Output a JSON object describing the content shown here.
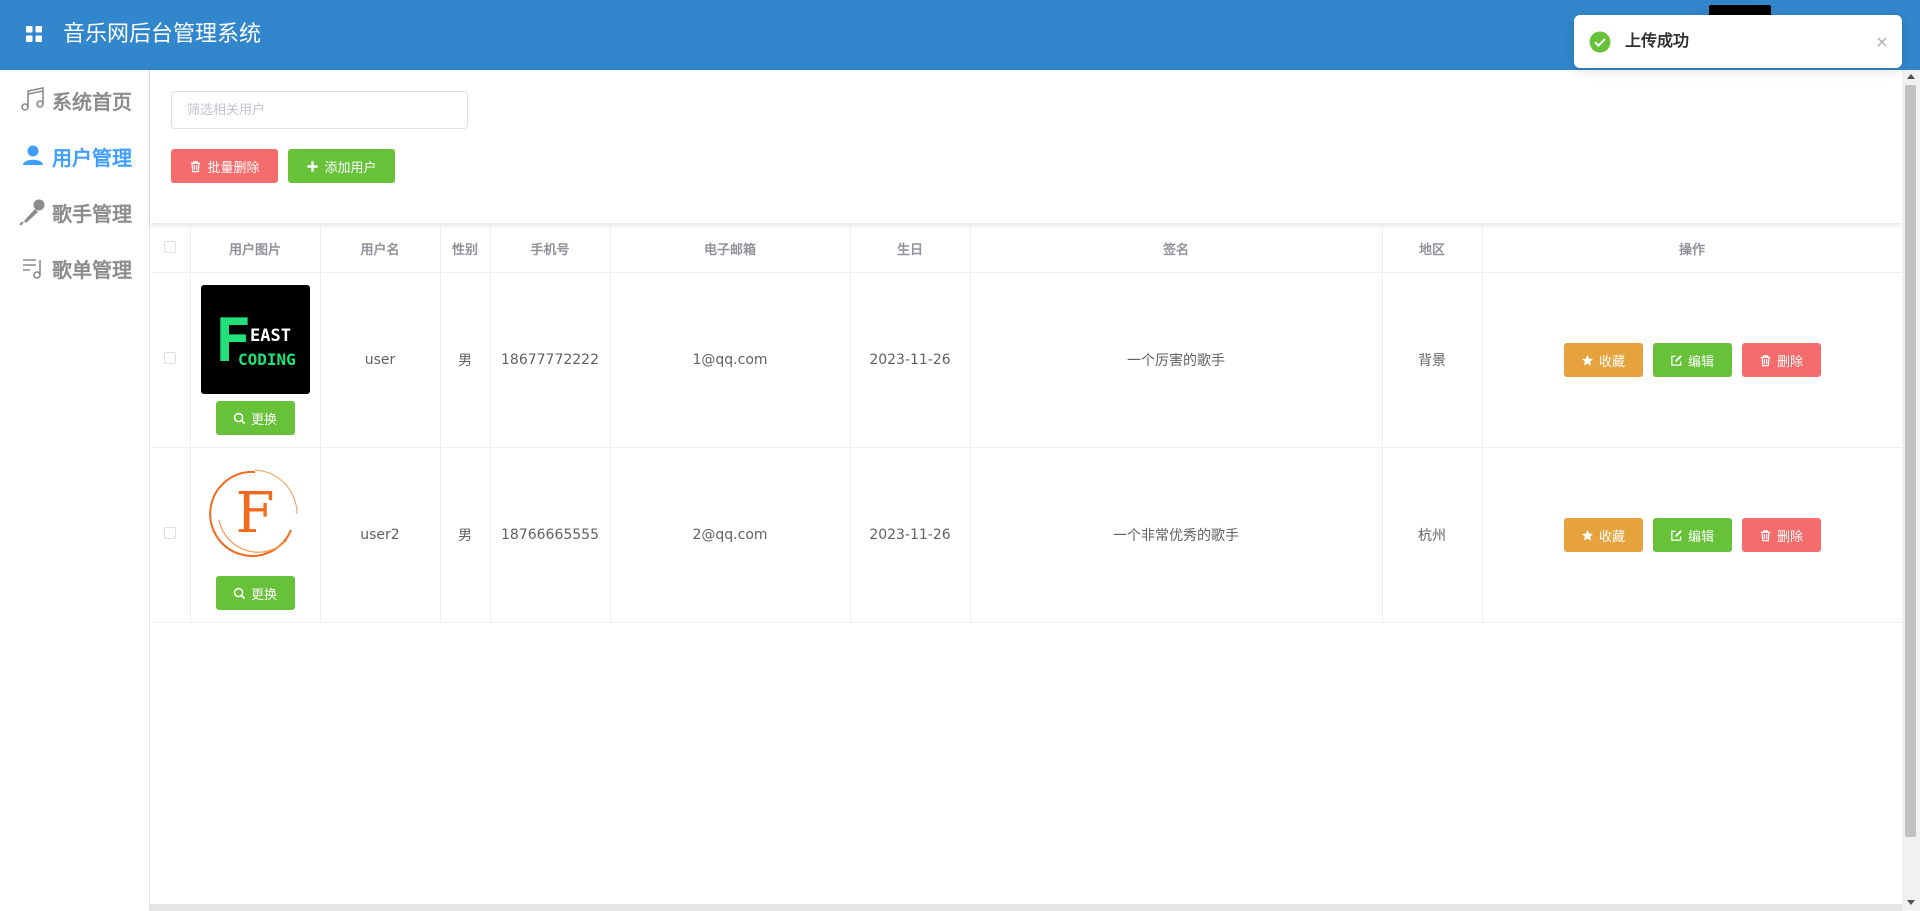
{
  "app": {
    "title": "音乐网后台管理系统"
  },
  "sidebar": {
    "items": [
      {
        "label": "系统首页",
        "icon": "music-note-icon",
        "active": false
      },
      {
        "label": "用户管理",
        "icon": "user-icon",
        "active": true
      },
      {
        "label": "歌手管理",
        "icon": "microphone-icon",
        "active": false
      },
      {
        "label": "歌单管理",
        "icon": "playlist-icon",
        "active": false
      }
    ]
  },
  "toolbar": {
    "search_placeholder": "筛选相关用户",
    "search_value": "",
    "batch_delete_label": "批量删除",
    "add_user_label": "添加用户"
  },
  "table": {
    "columns": [
      "用户图片",
      "用户名",
      "性别",
      "手机号",
      "电子邮箱",
      "生日",
      "签名",
      "地区",
      "操作"
    ],
    "rows": [
      {
        "avatar": "feast-coding-logo",
        "avatar_text_1": "F",
        "avatar_text_2": "EAST",
        "avatar_text_3": "CODING",
        "change_label": "更换",
        "username": "user",
        "gender": "男",
        "phone": "18677772222",
        "email": "1@qq.com",
        "birthday": "2023-11-26",
        "signature": "一个厉害的歌手",
        "region": "背景",
        "fav_label": "收藏",
        "edit_label": "编辑",
        "delete_label": "删除"
      },
      {
        "avatar": "f-circle-logo",
        "avatar_text_1": "F",
        "change_label": "更换",
        "username": "user2",
        "gender": "男",
        "phone": "18766665555",
        "email": "2@qq.com",
        "birthday": "2023-11-26",
        "signature": "一个非常优秀的歌手",
        "region": "杭州",
        "fav_label": "收藏",
        "edit_label": "编辑",
        "delete_label": "删除"
      }
    ]
  },
  "toast": {
    "message": "上传成功",
    "icon": "check-circle-icon"
  },
  "colors": {
    "header": "#3287cc",
    "primary": "#409eff",
    "danger": "#f56c6c",
    "success": "#67c23a",
    "warning": "#e6a23c",
    "border": "#ebeef5"
  }
}
